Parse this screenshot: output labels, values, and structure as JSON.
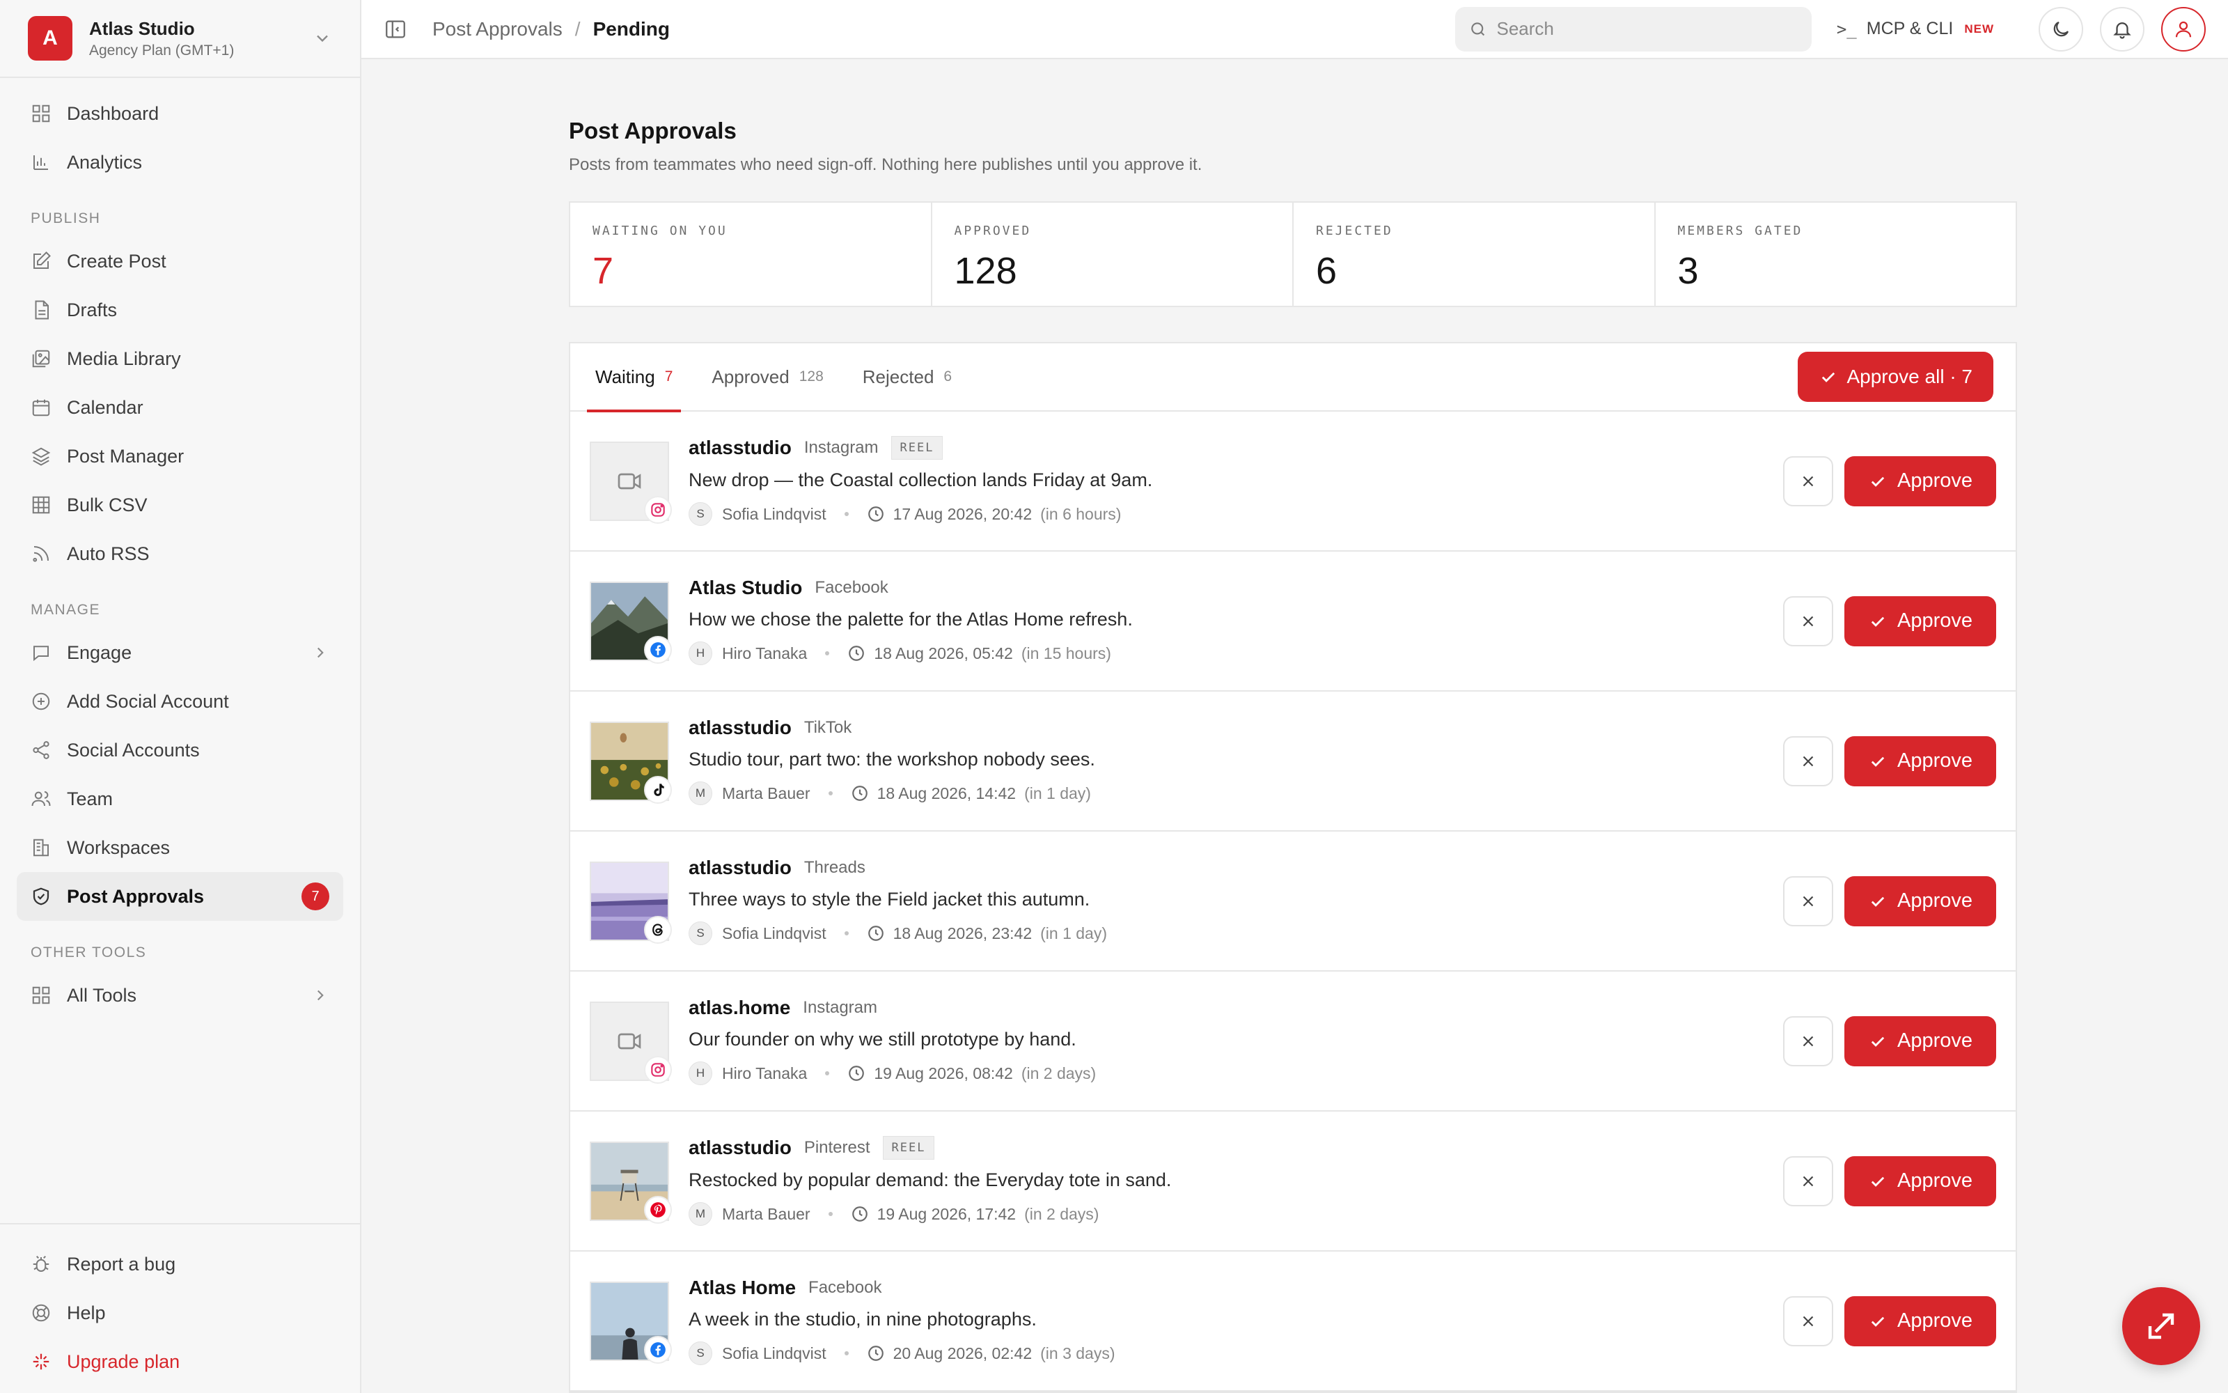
{
  "workspace": {
    "initial": "A",
    "name": "Atlas Studio",
    "plan": "Agency Plan (GMT+1)"
  },
  "nav": {
    "top": [
      {
        "label": "Dashboard",
        "icon": "grid-icon"
      },
      {
        "label": "Analytics",
        "icon": "bar-chart-icon"
      }
    ],
    "publish_title": "PUBLISH",
    "publish": [
      {
        "label": "Create Post",
        "icon": "edit-icon"
      },
      {
        "label": "Drafts",
        "icon": "file-icon"
      },
      {
        "label": "Media Library",
        "icon": "image-icon"
      },
      {
        "label": "Calendar",
        "icon": "calendar-icon"
      },
      {
        "label": "Post Manager",
        "icon": "layers-icon"
      },
      {
        "label": "Bulk CSV",
        "icon": "table-icon"
      },
      {
        "label": "Auto RSS",
        "icon": "rss-icon"
      }
    ],
    "manage_title": "MANAGE",
    "manage": [
      {
        "label": "Engage",
        "icon": "message-icon"
      },
      {
        "label": "Add Social Account",
        "icon": "plus-circle-icon"
      },
      {
        "label": "Social Accounts",
        "icon": "share-icon"
      },
      {
        "label": "Team",
        "icon": "users-icon"
      },
      {
        "label": "Workspaces",
        "icon": "building-icon"
      },
      {
        "label": "Post Approvals",
        "icon": "shield-check-icon",
        "badge": "7"
      }
    ],
    "other_title": "OTHER TOOLS",
    "other": [
      {
        "label": "All Tools",
        "icon": "grid-icon"
      }
    ],
    "bottom": [
      {
        "label": "Report a bug",
        "icon": "bug-icon"
      },
      {
        "label": "Help",
        "icon": "lifebuoy-icon"
      },
      {
        "label": "Upgrade plan",
        "icon": "sparkle-icon"
      }
    ]
  },
  "topbar": {
    "breadcrumb_parent": "Post Approvals",
    "breadcrumb_sep": "/",
    "breadcrumb_current": "Pending",
    "search_placeholder": "Search",
    "mcp_prompt": ">_",
    "mcp_label": "MCP & CLI",
    "mcp_badge": "NEW"
  },
  "page": {
    "title": "Post Approvals",
    "subtitle": "Posts from teammates who need sign-off. Nothing here publishes until you approve it."
  },
  "stats": [
    {
      "label": "WAITING ON YOU",
      "value": "7"
    },
    {
      "label": "APPROVED",
      "value": "128"
    },
    {
      "label": "REJECTED",
      "value": "6"
    },
    {
      "label": "MEMBERS GATED",
      "value": "3"
    }
  ],
  "tabs": [
    {
      "label": "Waiting",
      "count": "7"
    },
    {
      "label": "Approved",
      "count": "128"
    },
    {
      "label": "Rejected",
      "count": "6"
    }
  ],
  "approve_all_label": "Approve all · 7",
  "approve_label": "Approve",
  "posts": [
    {
      "account": "atlasstudio",
      "network": "Instagram",
      "tag": "REEL",
      "text": "New drop — the Coastal collection lands Friday at 9am.",
      "author_initial": "S",
      "author": "Sofia Lindqvist",
      "datetime": "17 Aug 2026, 20:42",
      "relative": "(in 6 hours)"
    },
    {
      "account": "Atlas Studio",
      "network": "Facebook",
      "tag": "",
      "text": "How we chose the palette for the Atlas Home refresh.",
      "author_initial": "H",
      "author": "Hiro Tanaka",
      "datetime": "18 Aug 2026, 05:42",
      "relative": "(in 15 hours)"
    },
    {
      "account": "atlasstudio",
      "network": "TikTok",
      "tag": "",
      "text": "Studio tour, part two: the workshop nobody sees.",
      "author_initial": "M",
      "author": "Marta Bauer",
      "datetime": "18 Aug 2026, 14:42",
      "relative": "(in 1 day)"
    },
    {
      "account": "atlasstudio",
      "network": "Threads",
      "tag": "",
      "text": "Three ways to style the Field jacket this autumn.",
      "author_initial": "S",
      "author": "Sofia Lindqvist",
      "datetime": "18 Aug 2026, 23:42",
      "relative": "(in 1 day)"
    },
    {
      "account": "atlas.home",
      "network": "Instagram",
      "tag": "",
      "text": "Our founder on why we still prototype by hand.",
      "author_initial": "H",
      "author": "Hiro Tanaka",
      "datetime": "19 Aug 2026, 08:42",
      "relative": "(in 2 days)"
    },
    {
      "account": "atlasstudio",
      "network": "Pinterest",
      "tag": "REEL",
      "text": "Restocked by popular demand: the Everyday tote in sand.",
      "author_initial": "M",
      "author": "Marta Bauer",
      "datetime": "19 Aug 2026, 17:42",
      "relative": "(in 2 days)"
    },
    {
      "account": "Atlas Home",
      "network": "Facebook",
      "tag": "",
      "text": "A week in the studio, in nine photographs.",
      "author_initial": "S",
      "author": "Sofia Lindqvist",
      "datetime": "20 Aug 2026, 02:42",
      "relative": "(in 3 days)"
    }
  ],
  "colors": {
    "accent": "#d7262b",
    "instagram": "#e1306c",
    "facebook": "#1877f2",
    "pinterest": "#e60023"
  }
}
